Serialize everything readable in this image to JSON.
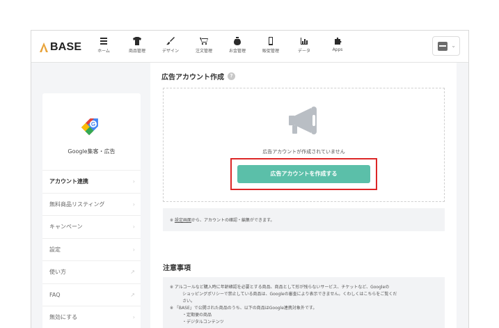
{
  "brand": {
    "name": "BASE"
  },
  "nav": [
    {
      "label": "ホーム",
      "icon": "list-icon"
    },
    {
      "label": "商品管理",
      "icon": "shirt-icon"
    },
    {
      "label": "デザイン",
      "icon": "brush-icon"
    },
    {
      "label": "注文管理",
      "icon": "cart-icon"
    },
    {
      "label": "お金管理",
      "icon": "money-bag-icon"
    },
    {
      "label": "販促管理",
      "icon": "phone-icon"
    },
    {
      "label": "データ",
      "icon": "bar-chart-icon"
    },
    {
      "label": "Apps",
      "icon": "puzzle-icon"
    }
  ],
  "sidebar": {
    "title": "Google集客・広告",
    "items": [
      {
        "label": "アカウント連携",
        "active": true,
        "kind": "chevron"
      },
      {
        "label": "無料商品リスティング",
        "kind": "chevron"
      },
      {
        "label": "キャンペーン",
        "kind": "chevron"
      },
      {
        "label": "設定",
        "kind": "chevron"
      },
      {
        "label": "使い方",
        "kind": "external"
      },
      {
        "label": "FAQ",
        "kind": "external"
      },
      {
        "label": "無効にする",
        "kind": "chevron"
      }
    ]
  },
  "main": {
    "title": "広告アカウント作成",
    "help": "?",
    "empty_message": "広告アカウントが作成されていません",
    "cta_label": "広告アカウントを作成する",
    "note_prefix": "※ ",
    "note_link": "設定画面",
    "note_suffix": "から、アカウントの確認・編集ができます。",
    "caution_title": "注意事項",
    "caution_lines": [
      "※ アルコールなど購入時に年齢確認を必要とする商品、商品として形が残らないサービス、チケットなど、Googleの",
      "ショッピングポリシーで禁止している商品は、Googleの審査により表示できません。くわしくはこちらをご覧くだ",
      "さい。",
      "※ 「BASE」で公開された商品のうち、以下の商品はGoogle連携対象外です。",
      "・定期便の商品",
      "・デジタルコンテンツ"
    ]
  },
  "colors": {
    "accent": "#5bbfa9",
    "highlight": "#dc2626"
  }
}
